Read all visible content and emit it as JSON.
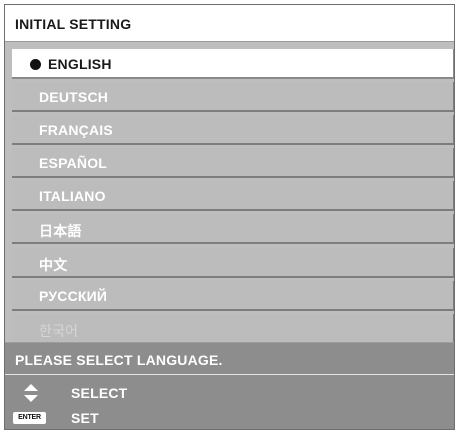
{
  "window": {
    "title": "INITIAL SETTING"
  },
  "languages": [
    {
      "label": "ENGLISH",
      "selected": true
    },
    {
      "label": "DEUTSCH",
      "selected": false
    },
    {
      "label": "FRANÇAIS",
      "selected": false
    },
    {
      "label": "ESPAÑOL",
      "selected": false
    },
    {
      "label": "ITALIANO",
      "selected": false
    },
    {
      "label": "日本語",
      "selected": false
    },
    {
      "label": "中文",
      "selected": false
    },
    {
      "label": "РУССКИЙ",
      "selected": false
    },
    {
      "label": "한국어",
      "selected": false
    }
  ],
  "status": {
    "message": "PLEASE SELECT LANGUAGE."
  },
  "help": {
    "select_icon": "up-down-arrows-icon",
    "select_label": "SELECT",
    "enter_icon_text": "ENTER",
    "set_label": "SET"
  },
  "colors": {
    "menu_background": "#bebebe",
    "selected_item": "#ffffff",
    "status_background": "#8d8d8d",
    "text_light": "#ffffff",
    "text_dark": "#1a1a1a"
  }
}
